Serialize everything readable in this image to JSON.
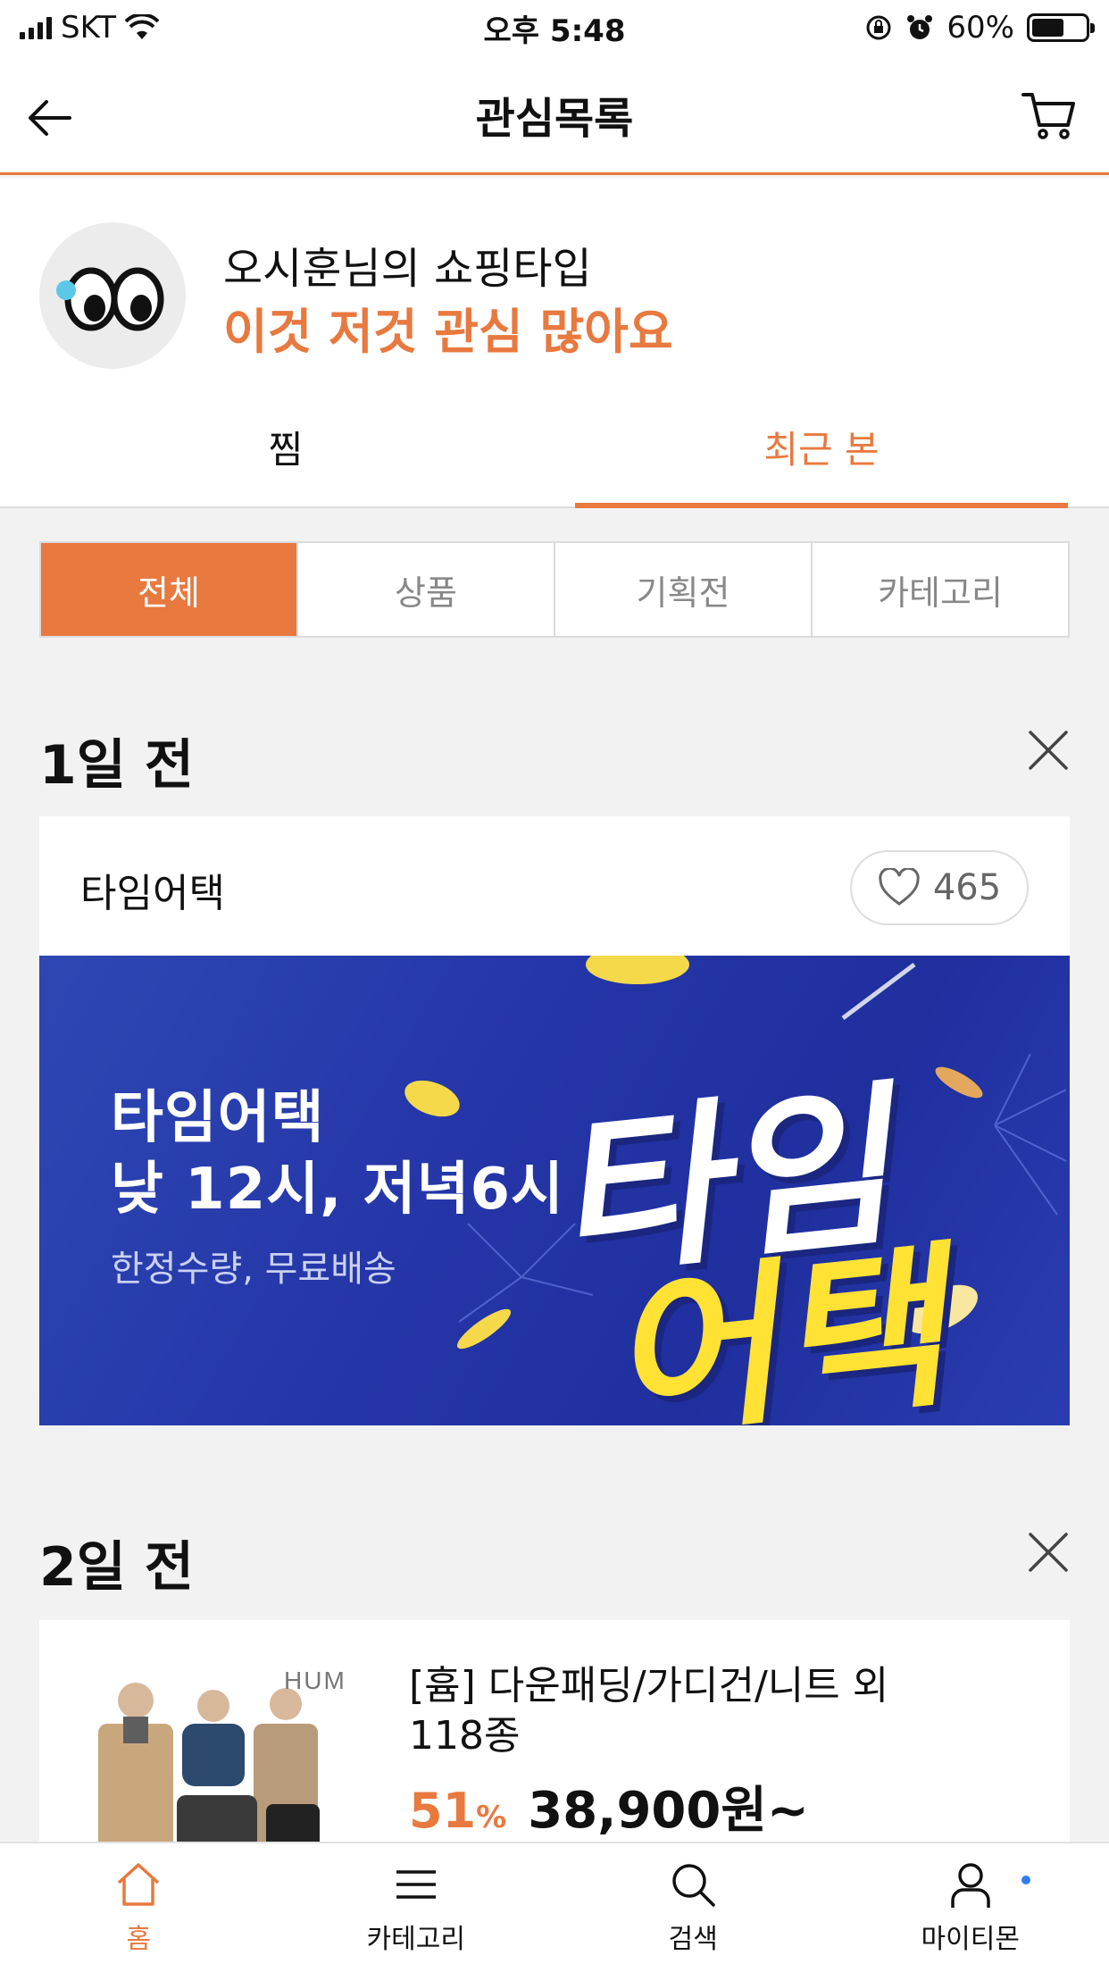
{
  "status_bar": {
    "carrier": "SKT",
    "time": "오후 5:48",
    "battery_pct": "60%",
    "battery_level": 0.6
  },
  "header": {
    "title": "관심목록",
    "back_icon": "arrow-left-icon",
    "cart_icon": "cart-icon"
  },
  "profile": {
    "line1": "오시훈님의 쇼핑타입",
    "line2": "이것 저것 관심 많아요",
    "avatar_icon": "eyes-icon"
  },
  "tabs": [
    {
      "label": "찜",
      "active": false
    },
    {
      "label": "최근 본",
      "active": true
    }
  ],
  "filters": [
    {
      "label": "전체",
      "active": true
    },
    {
      "label": "상품",
      "active": false
    },
    {
      "label": "기획전",
      "active": false
    },
    {
      "label": "카테고리",
      "active": false
    }
  ],
  "sections": [
    {
      "title": "1일 전",
      "card": {
        "title": "타임어택",
        "likes": "465",
        "banner": {
          "line1": "타임어택",
          "line2": "낮 12시, 저녁6시",
          "line3": "한정수량, 무료배송",
          "big1": "타임",
          "big2": "어택"
        }
      }
    },
    {
      "title": "2일 전",
      "product": {
        "brand": "HUM",
        "title": "[흄] 다운패딩/가디건/니트 외 118종",
        "discount": "51",
        "discount_unit": "%",
        "price": "38,900원~"
      }
    }
  ],
  "bottom_nav": [
    {
      "label": "홈",
      "icon": "home-icon",
      "active": true
    },
    {
      "label": "카테고리",
      "icon": "menu-icon",
      "active": false
    },
    {
      "label": "검색",
      "icon": "search-icon",
      "active": false
    },
    {
      "label": "마이티몬",
      "icon": "user-icon",
      "active": false
    }
  ],
  "colors": {
    "accent": "#e8793f",
    "banner_blue": "#2536a8",
    "banner_yellow": "#ffe234",
    "notification_dot": "#2f7ff0"
  }
}
